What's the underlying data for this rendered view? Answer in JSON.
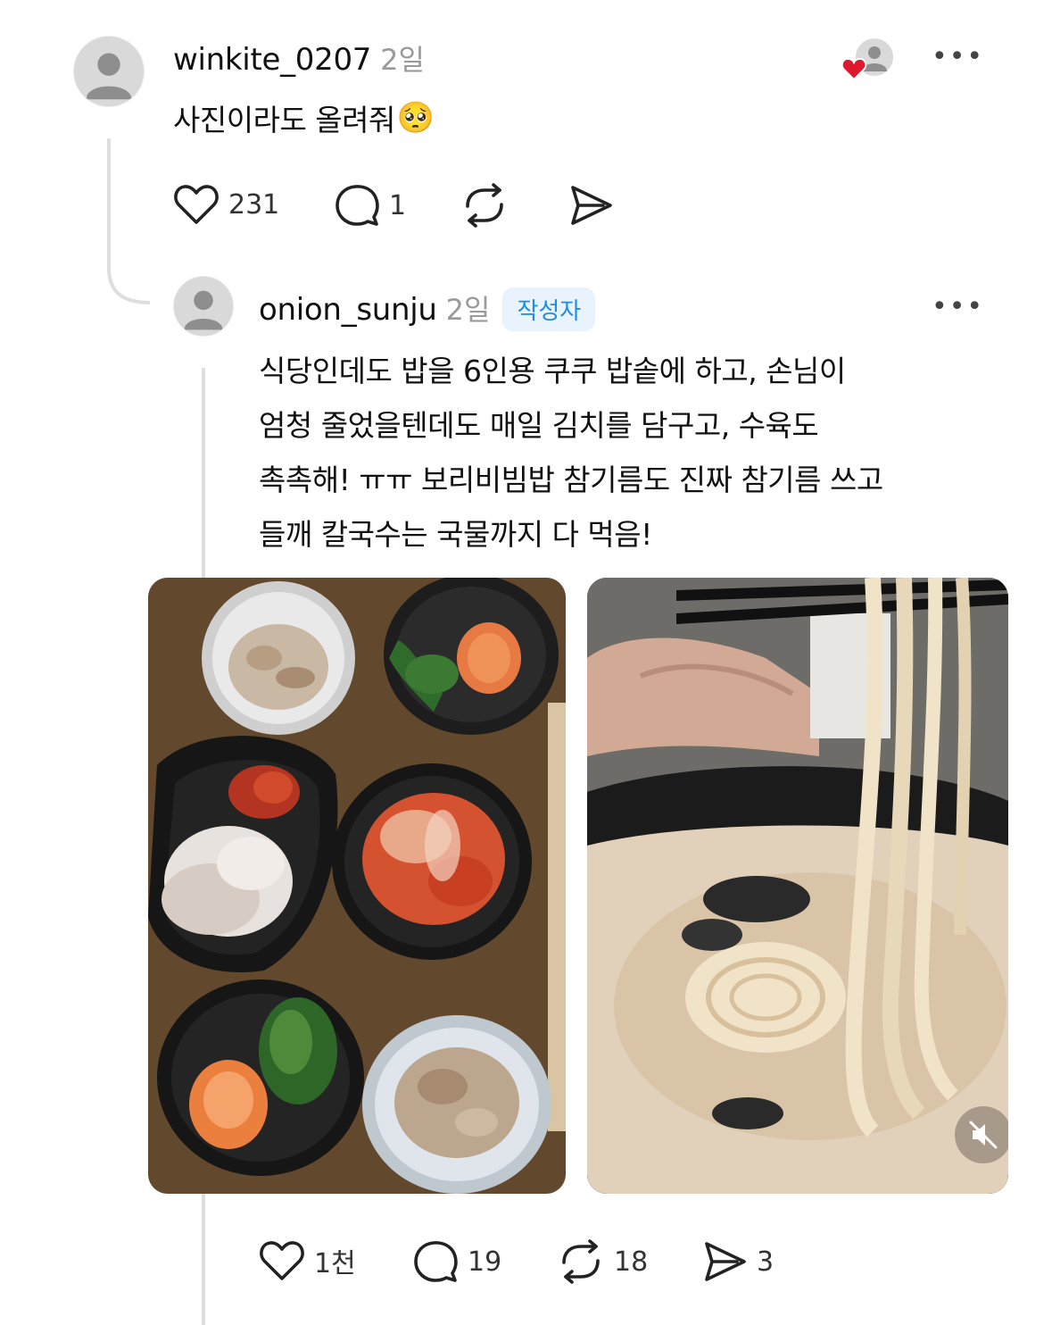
{
  "comment": {
    "username": "winkite_0207",
    "time": "2일",
    "text": "사진이라도 올려줘",
    "emoji": "🥺",
    "likes": "231",
    "replies": "1"
  },
  "reply": {
    "username": "onion_sunju",
    "time": "2일",
    "author_badge": "작성자",
    "text": "식당인데도 밥을 6인용 쿠쿠 밥솥에 하고, 손님이\n엄청 줄었을텐데도 매일 김치를 담구고, 수육도\n촉촉해! ㅠㅠ 보리비빔밥 참기름도 진짜 참기름 쓰고\n들깨 칼국수는 국물까지 다 먹음!",
    "likes": "1천",
    "replies": "19",
    "reposts": "18",
    "shares": "3"
  },
  "icons": {
    "more": "more-icon",
    "like": "heart-icon",
    "reply": "comment-icon",
    "repost": "repost-icon",
    "share": "send-icon",
    "liked_by_author": "liked-by-author-icon",
    "mute": "mute-icon"
  },
  "colors": {
    "badge_bg": "#e8f3fd",
    "badge_text": "#1f8ce0",
    "heart_red": "#e0182d",
    "muted_text": "#9a9a9a"
  }
}
